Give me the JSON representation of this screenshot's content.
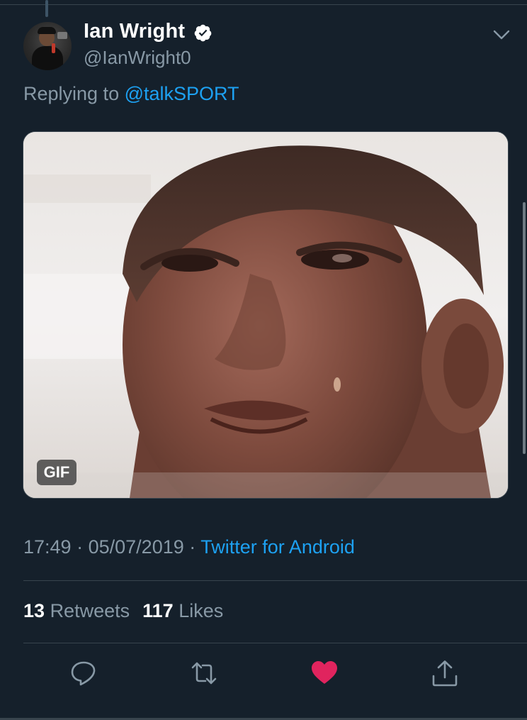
{
  "tweet": {
    "display_name": "Ian Wright",
    "handle": "@IanWright0",
    "verified": true,
    "replying_to_prefix": "Replying to ",
    "replying_to_mention": "@talkSPORT",
    "media_badge": "GIF",
    "time": "17:49",
    "separator": "·",
    "date": "05/07/2019",
    "source": "Twitter for Android",
    "retweets_count": "13",
    "retweets_label": "Retweets",
    "likes_count": "117",
    "likes_label": "Likes",
    "liked": true
  },
  "icons": {
    "verified": "verified-badge-icon",
    "menu": "chevron-down-icon",
    "reply": "reply-icon",
    "retweet": "retweet-icon",
    "like": "heart-icon",
    "share": "share-icon"
  },
  "colors": {
    "background": "#15202b",
    "accent": "#1da1f2",
    "secondary_text": "#8899a6",
    "like": "#e0245e",
    "divider": "#38444d"
  }
}
